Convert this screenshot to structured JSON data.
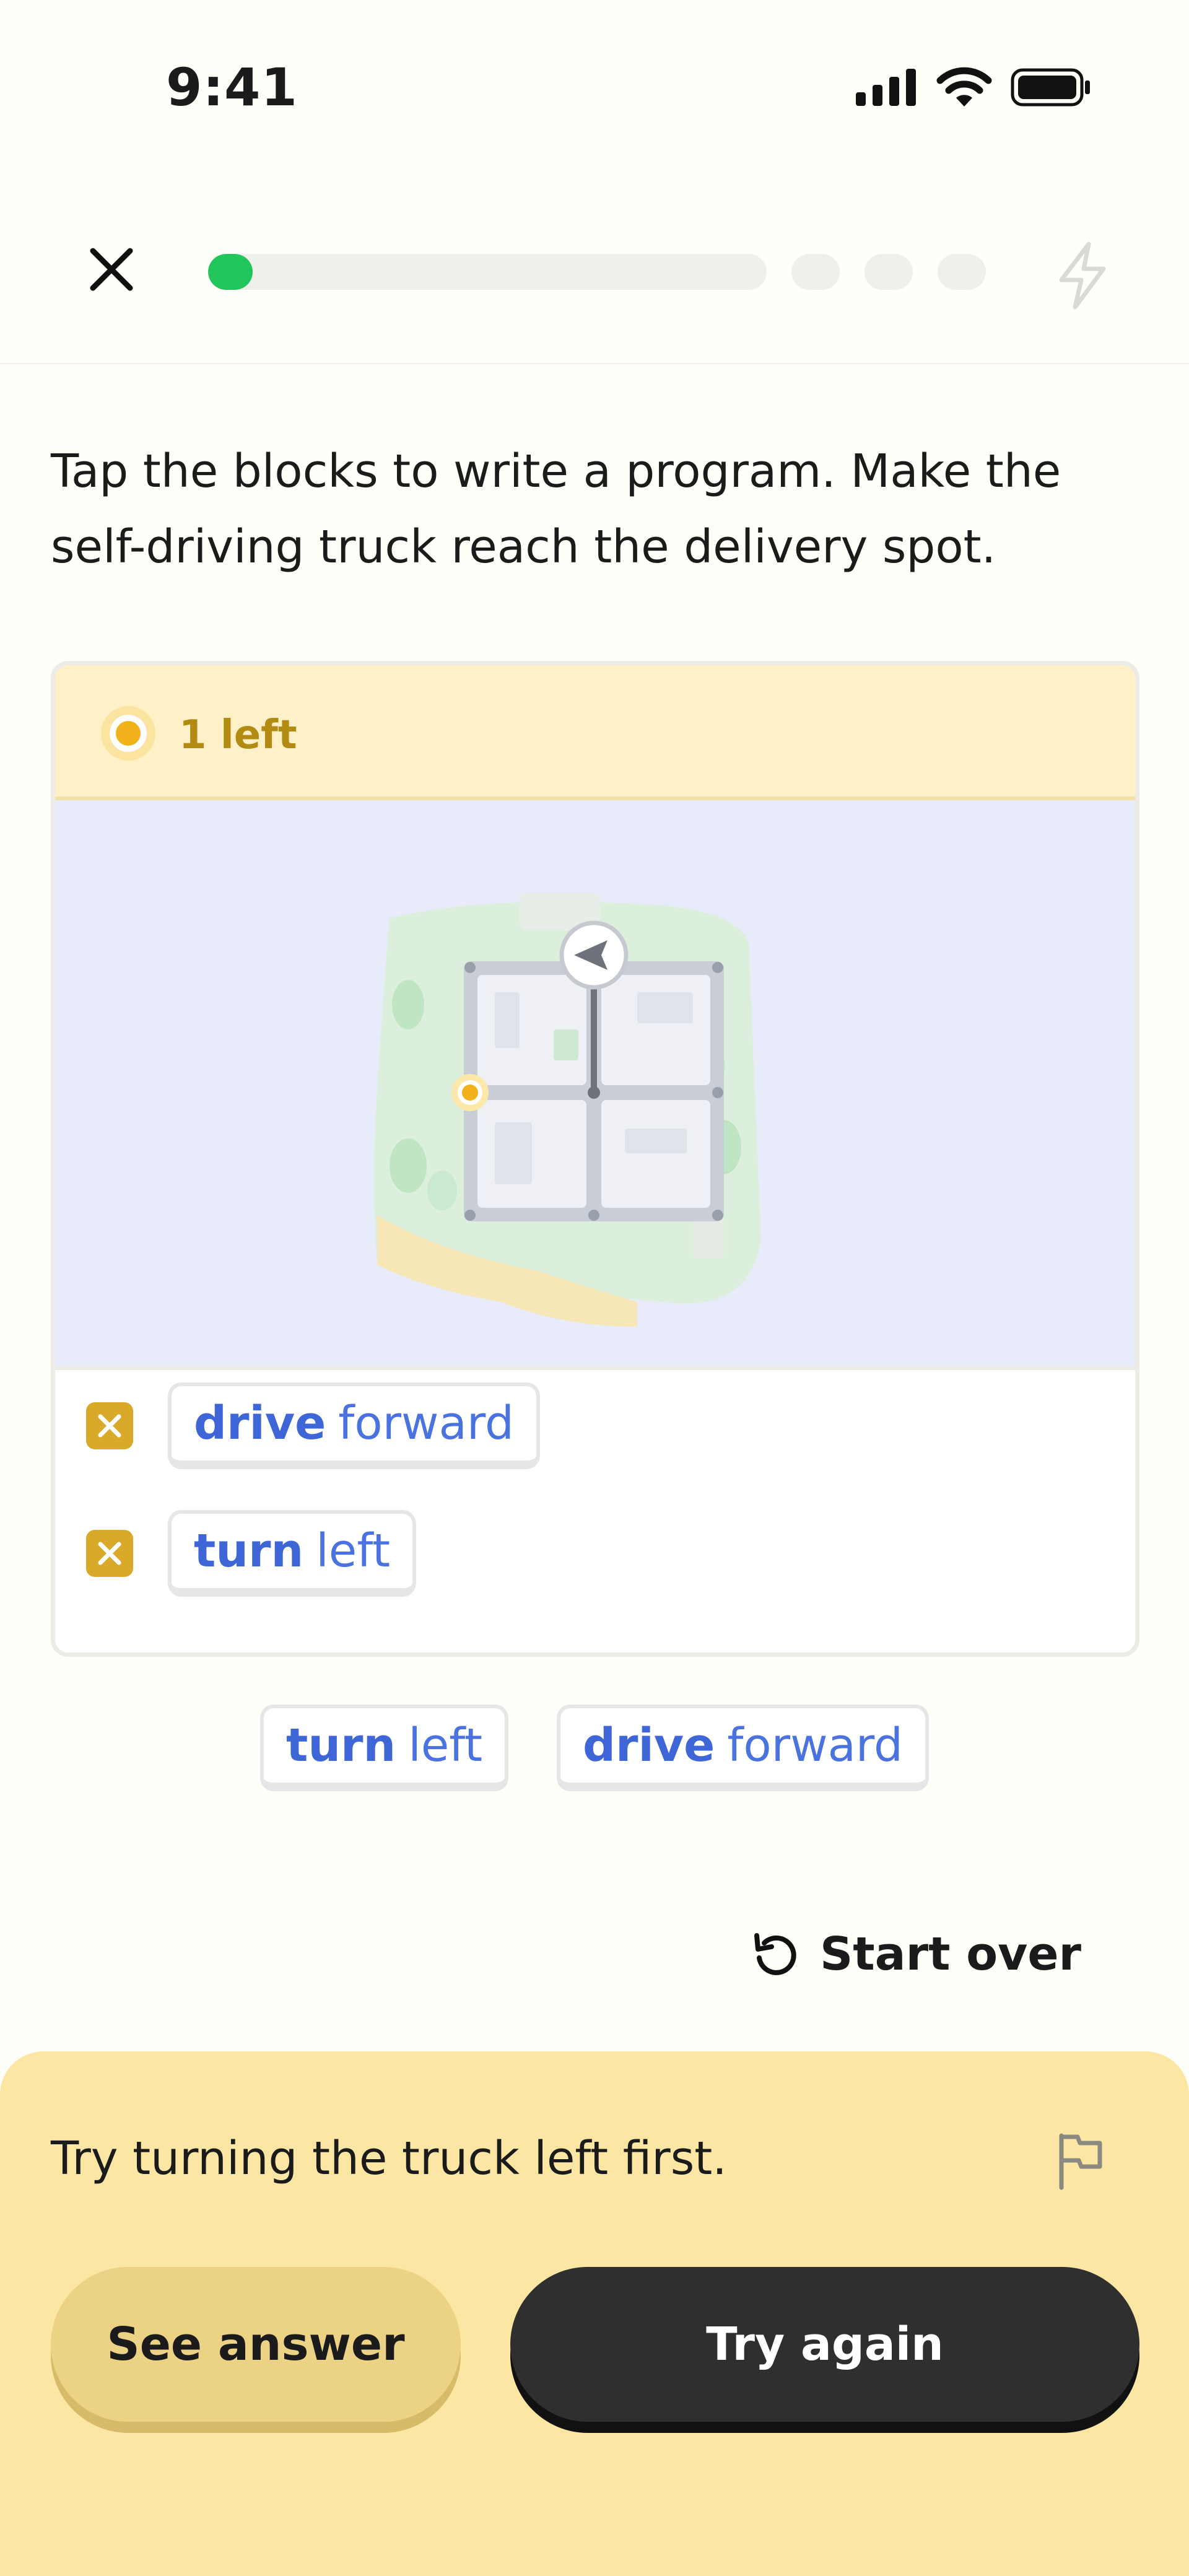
{
  "status_bar": {
    "time": "9:41"
  },
  "header": {
    "progress_fraction": 0.08,
    "remaining_segments": 3
  },
  "prompt": {
    "line1": "Tap the blocks to write a program. Make the",
    "line2": "self-driving truck reach the delivery spot."
  },
  "card": {
    "remaining_label": "1 left",
    "program": [
      {
        "verb": "drive",
        "arg": "forward"
      },
      {
        "verb": "turn",
        "arg": "left"
      }
    ]
  },
  "block_bank": [
    {
      "verb": "turn",
      "arg": "left"
    },
    {
      "verb": "drive",
      "arg": "forward"
    }
  ],
  "start_over_label": "Start over",
  "feedback": {
    "hint": "Try turning the truck left first.",
    "see_answer_label": "See answer",
    "try_again_label": "Try again"
  },
  "colors": {
    "accent_green": "#22c45c",
    "block_blue": "#4a72e0",
    "target_yellow": "#f2b21b",
    "sheet": "#fbe7a3"
  }
}
